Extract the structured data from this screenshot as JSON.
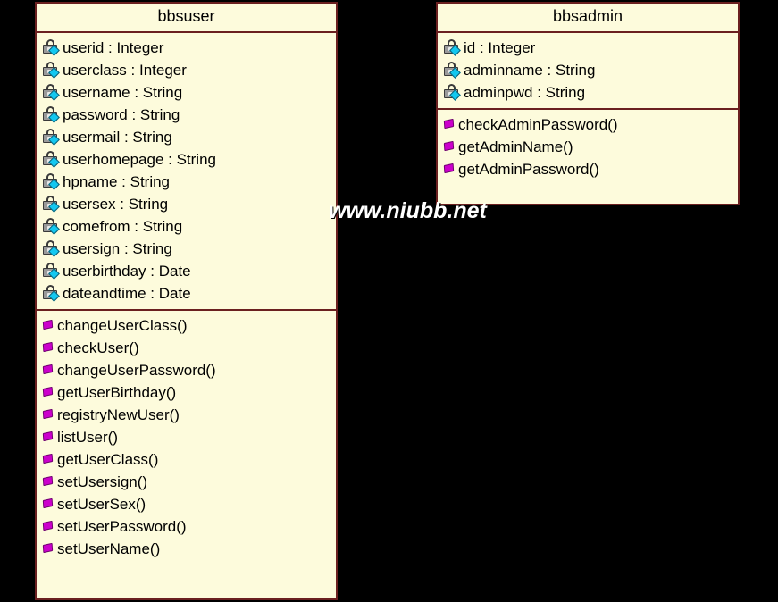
{
  "diagram": {
    "type": "uml-class-diagram",
    "background_color": "#000000",
    "class_fill_color": "#FDFBDC",
    "class_border_color": "#6B2020",
    "attribute_icon": "private-attribute-padlock-icon",
    "method_icon": "public-method-diamond-icon"
  },
  "watermark": {
    "text": "www.niubb.net"
  },
  "classes": [
    {
      "id": "bbsuser",
      "name": "bbsuser",
      "attributes": [
        {
          "label": "userid : Integer",
          "visibility": "private"
        },
        {
          "label": "userclass : Integer",
          "visibility": "private"
        },
        {
          "label": "username : String",
          "visibility": "private"
        },
        {
          "label": "password : String",
          "visibility": "private"
        },
        {
          "label": "usermail : String",
          "visibility": "private"
        },
        {
          "label": "userhomepage : String",
          "visibility": "private"
        },
        {
          "label": "hpname : String",
          "visibility": "private"
        },
        {
          "label": "usersex : String",
          "visibility": "private"
        },
        {
          "label": "comefrom : String",
          "visibility": "private"
        },
        {
          "label": "usersign : String",
          "visibility": "private"
        },
        {
          "label": "userbirthday : Date",
          "visibility": "private"
        },
        {
          "label": "dateandtime : Date",
          "visibility": "private"
        }
      ],
      "methods": [
        {
          "label": "changeUserClass()",
          "visibility": "public"
        },
        {
          "label": "checkUser()",
          "visibility": "public"
        },
        {
          "label": "changeUserPassword()",
          "visibility": "public"
        },
        {
          "label": "getUserBirthday()",
          "visibility": "public"
        },
        {
          "label": "registryNewUser()",
          "visibility": "public"
        },
        {
          "label": "listUser()",
          "visibility": "public"
        },
        {
          "label": "getUserClass()",
          "visibility": "public"
        },
        {
          "label": "setUsersign()",
          "visibility": "public"
        },
        {
          "label": "setUserSex()",
          "visibility": "public"
        },
        {
          "label": "setUserPassword()",
          "visibility": "public"
        },
        {
          "label": "setUserName()",
          "visibility": "public"
        }
      ]
    },
    {
      "id": "bbsadmin",
      "name": "bbsadmin",
      "attributes": [
        {
          "label": "id : Integer",
          "visibility": "private"
        },
        {
          "label": "adminname : String",
          "visibility": "private"
        },
        {
          "label": "adminpwd : String",
          "visibility": "private"
        }
      ],
      "methods": [
        {
          "label": "checkAdminPassword()",
          "visibility": "public"
        },
        {
          "label": "getAdminName()",
          "visibility": "public"
        },
        {
          "label": "getAdminPassword()",
          "visibility": "public"
        }
      ]
    }
  ]
}
